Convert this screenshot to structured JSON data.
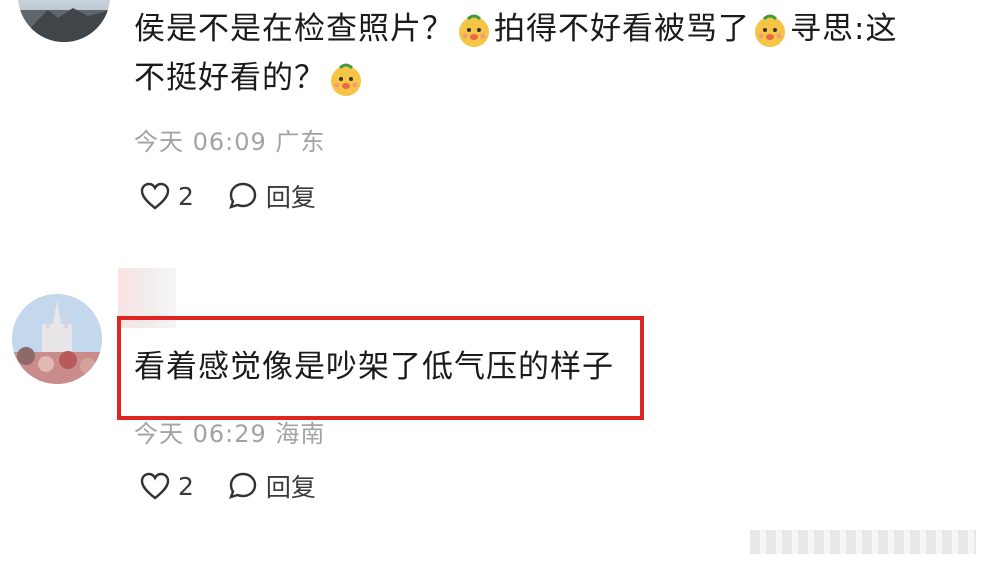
{
  "comments": [
    {
      "text_line1_parts": [
        "侯是不是在检查照片？",
        "拍得不好看被骂了",
        "寻思:这"
      ],
      "text_line2_parts": [
        "不挺好看的？"
      ],
      "emoji_icon": "chick-face-emoji-icon",
      "meta": "今天 06:09 广东",
      "likes": "2",
      "reply_label": "回复"
    },
    {
      "text": "看着感觉像是吵架了低气压的样子",
      "meta": "今天 06:29 海南",
      "likes": "2",
      "reply_label": "回复"
    }
  ],
  "highlight_color": "#e02323"
}
